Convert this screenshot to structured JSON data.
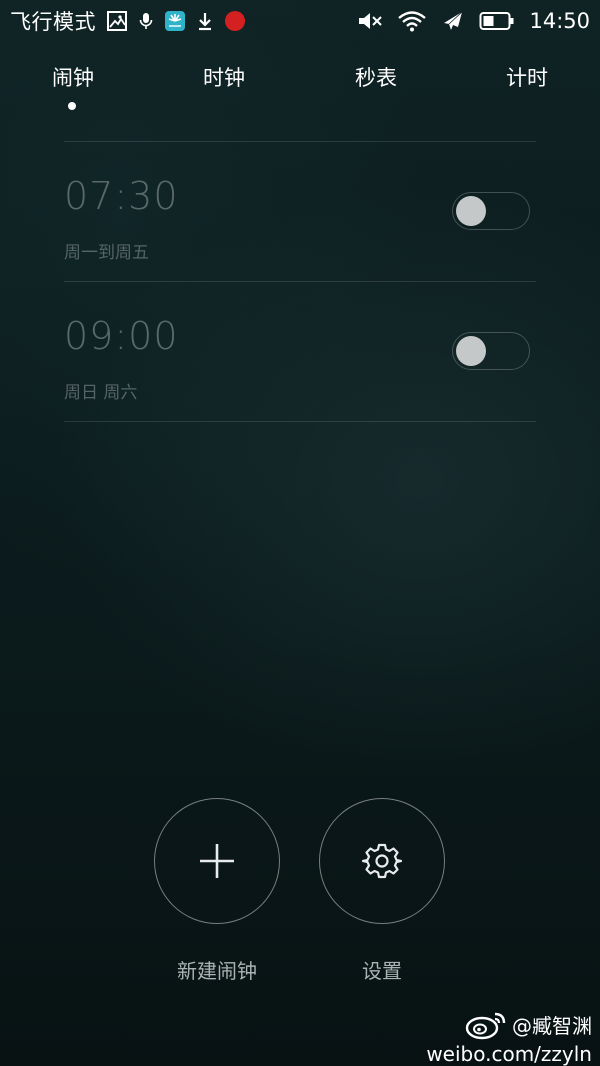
{
  "status_bar": {
    "carrier_text": "飞行模式",
    "time": "14:50",
    "icons_left": [
      "image-icon",
      "mic-icon",
      "huawei-icon",
      "download-icon",
      "record-icon"
    ],
    "icons_right": [
      "mute-icon",
      "wifi-icon",
      "airplane-icon",
      "battery-icon"
    ],
    "record_color": "#d42020",
    "huawei_color": "#2fb3c9"
  },
  "tabs": [
    {
      "label": "闹钟",
      "active": true
    },
    {
      "label": "时钟",
      "active": false
    },
    {
      "label": "秒表",
      "active": false
    },
    {
      "label": "计时",
      "active": false
    }
  ],
  "alarms": [
    {
      "time": "07:30",
      "repeat": "周一到周五",
      "enabled": false
    },
    {
      "time": "09:00",
      "repeat": "周日 周六",
      "enabled": false
    }
  ],
  "actions": {
    "new_alarm_label": "新建闹钟",
    "settings_label": "设置"
  },
  "watermark": {
    "handle": "@臧智渊",
    "url": "weibo.com/zzyln"
  }
}
